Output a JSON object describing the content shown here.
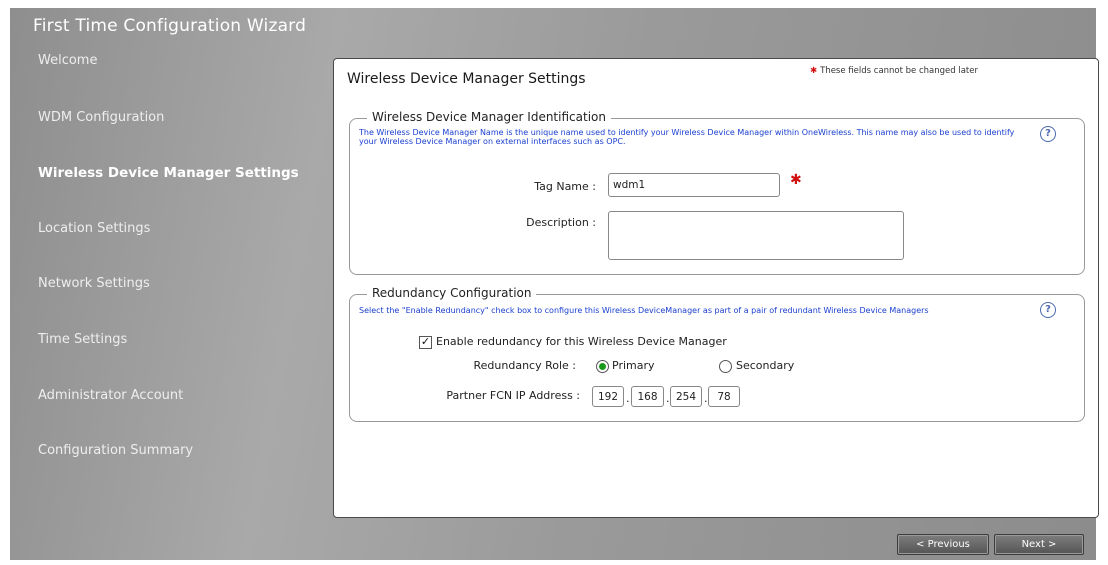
{
  "wizard": {
    "title": "First Time Configuration Wizard",
    "steps": [
      {
        "label": "Welcome"
      },
      {
        "label": "WDM Configuration"
      },
      {
        "label": "Wireless Device Manager Settings"
      },
      {
        "label": "Location Settings"
      },
      {
        "label": "Network Settings"
      },
      {
        "label": "Time Settings"
      },
      {
        "label": "Administrator Account"
      },
      {
        "label": "Configuration Summary"
      }
    ],
    "active_step": 2
  },
  "panel": {
    "title": "Wireless Device Manager Settings",
    "required_mark": "✱",
    "required_note": "These fields cannot be changed later"
  },
  "identification": {
    "legend": "Wireless Device Manager Identification",
    "description": "The Wireless Device Manager Name is the unique name used to identify your Wireless Device Manager within OneWireless. This name may also be used to identify your Wireless Device Manager on external interfaces such as OPC.",
    "help_icon": "?",
    "tag_name_label": "Tag Name :",
    "tag_name_value": "wdm1",
    "description_label": "Description :",
    "description_value": ""
  },
  "redundancy": {
    "legend": "Redundancy Configuration",
    "description": "Select the \"Enable Redundancy\" check box to configure this Wireless DeviceManager as part of a pair of redundant Wireless Device Managers",
    "help_icon": "?",
    "enable_checked": true,
    "check_glyph": "✓",
    "enable_label": "Enable redundancy for this Wireless Device Manager",
    "role_label": "Redundancy Role :",
    "role_primary": "Primary",
    "role_secondary": "Secondary",
    "role_selected": "Primary",
    "partner_label": "Partner FCN IP Address :",
    "ip": [
      "192",
      "168",
      "254",
      "78"
    ],
    "ip_separator": "."
  },
  "buttons": {
    "previous": "< Previous",
    "next": "Next >"
  }
}
